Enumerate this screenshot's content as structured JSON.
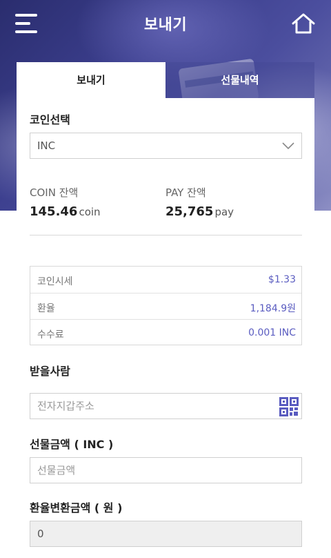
{
  "header": {
    "title": "보내기",
    "menu_icon": "hamburger-menu-icon",
    "home_icon": "home-icon"
  },
  "tabs": [
    {
      "label": "보내기",
      "active": true
    },
    {
      "label": "선물내역",
      "active": false
    }
  ],
  "coin_select": {
    "label": "코인선택",
    "value": "INC"
  },
  "balances": {
    "coin": {
      "label": "COIN 잔액",
      "amount": "145.46",
      "unit": "coin"
    },
    "pay": {
      "label": "PAY 잔액",
      "amount": "25,765",
      "unit": "pay"
    }
  },
  "info": [
    {
      "key": "코인시세",
      "value": "$1.33"
    },
    {
      "key": "환율",
      "value": "1,184.9원"
    },
    {
      "key": "수수료",
      "value": "0.001 INC"
    }
  ],
  "recipient": {
    "label": "받을사람",
    "placeholder": "전자지갑주소",
    "qr_icon": "qr-code-icon"
  },
  "gift_amount": {
    "label": "선물금액 ( INC )",
    "placeholder": "선물금액"
  },
  "converted_amount": {
    "label": "환율변환금액 ( 원 )",
    "value": "0"
  },
  "colors": {
    "accent": "#5a5cc0",
    "header_bg": "#3c3f8e"
  }
}
